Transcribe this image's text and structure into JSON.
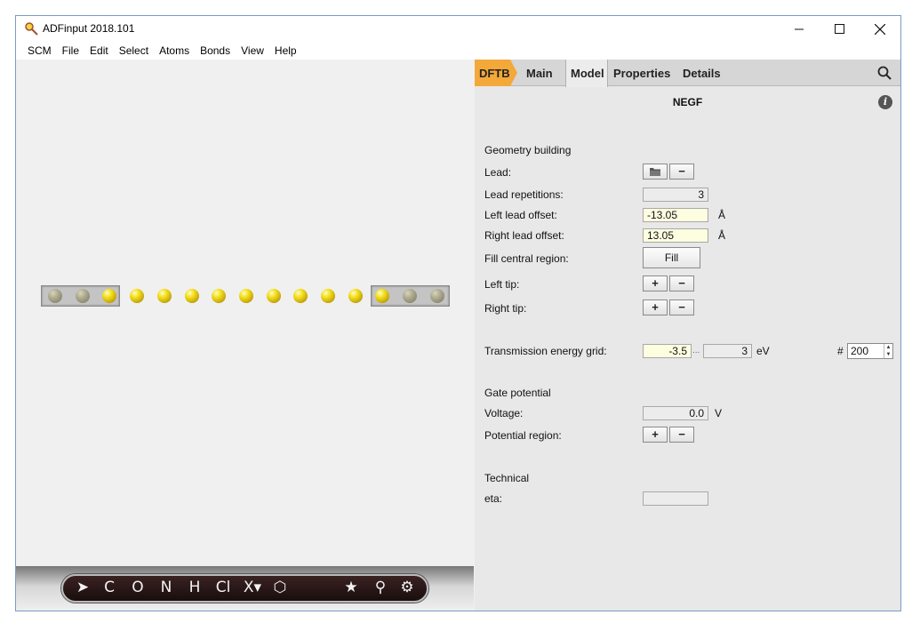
{
  "window": {
    "title": "ADFinput 2018.101",
    "minimize_icon": "minimize-icon",
    "maximize_icon": "maximize-icon",
    "close_icon": "close-icon"
  },
  "menu": [
    "SCM",
    "File",
    "Edit",
    "Select",
    "Atoms",
    "Bonds",
    "View",
    "Help"
  ],
  "toolbar": {
    "tools": [
      {
        "name": "select-arrow-tool",
        "glyph": "➤"
      },
      {
        "name": "carbon-tool",
        "glyph": "C"
      },
      {
        "name": "oxygen-tool",
        "glyph": "O"
      },
      {
        "name": "nitrogen-tool",
        "glyph": "N"
      },
      {
        "name": "hydrogen-tool",
        "glyph": "H"
      },
      {
        "name": "chlorine-tool",
        "glyph": "Cl"
      },
      {
        "name": "other-element-tool",
        "glyph": "X▾"
      },
      {
        "name": "ring-tool",
        "glyph": "⬡"
      },
      {
        "name": "favorite-star-tool",
        "glyph": "★"
      },
      {
        "name": "pin-tool",
        "glyph": "⚲"
      },
      {
        "name": "settings-gear-tool",
        "glyph": "⚙"
      }
    ]
  },
  "tabs": {
    "dftb": "DFTB",
    "main": "Main",
    "model": "Model",
    "properties": "Properties",
    "details": "Details",
    "active": "Model",
    "accent_color": "#f3a83a"
  },
  "panel": {
    "title": "NEGF",
    "info_glyph": "i",
    "geometry_section": "Geometry building",
    "lead_label": "Lead:",
    "lead_repetitions_label": "Lead repetitions:",
    "lead_repetitions_value": "3",
    "left_lead_offset_label": "Left lead offset:",
    "left_lead_offset_value": "-13.05",
    "right_lead_offset_label": "Right lead offset:",
    "right_lead_offset_value": "13.05",
    "angstrom_unit": "Å",
    "fill_central_label": "Fill central region:",
    "fill_button": "Fill",
    "left_tip_label": "Left tip:",
    "right_tip_label": "Right tip:",
    "transmission_label": "Transmission energy grid:",
    "transmission_min": "-3.5",
    "range_separator": "...",
    "transmission_max": "3",
    "ev_unit": "eV",
    "points_symbol": "#",
    "points_value": "200",
    "gate_section": "Gate potential",
    "voltage_label": "Voltage:",
    "voltage_value": "0.0",
    "volt_unit": "V",
    "potential_region_label": "Potential region:",
    "technical_section": "Technical",
    "eta_label": "eta:",
    "eta_value": "",
    "plus_glyph": "+",
    "minus_glyph": "−"
  },
  "molecule": {
    "atom_color": "#f5e21f",
    "atom_count": 15,
    "left_lead_atoms": 3,
    "right_lead_atoms": 3
  }
}
